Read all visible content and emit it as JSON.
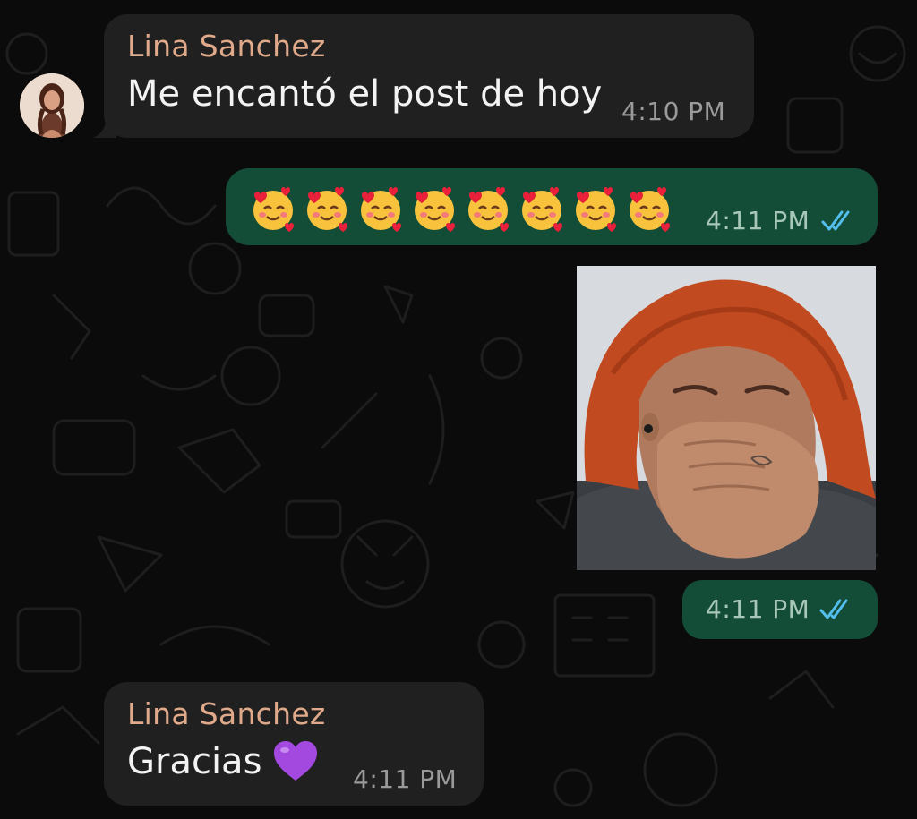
{
  "chat": {
    "messages": [
      {
        "direction": "incoming",
        "sender": "Lina Sanchez",
        "text": "Me encantó el post de hoy",
        "time": "4:10 PM"
      },
      {
        "direction": "outgoing",
        "content": "emoji",
        "emoji_name": "smiling-face-with-hearts",
        "emoji_count": 8,
        "time": "4:11 PM",
        "status": "read"
      },
      {
        "direction": "outgoing",
        "content": "sticker",
        "time": "4:11 PM",
        "status": "read"
      },
      {
        "direction": "incoming",
        "sender": "Lina Sanchez",
        "text": "Gracias",
        "emoji_name": "purple-heart",
        "time": "4:11 PM"
      }
    ]
  },
  "colors": {
    "background": "#0b0b0b",
    "incoming_bubble": "#202020",
    "outgoing_bubble": "#134d37",
    "sender_name": "#e0a98a",
    "read_ticks": "#53bdeb"
  }
}
